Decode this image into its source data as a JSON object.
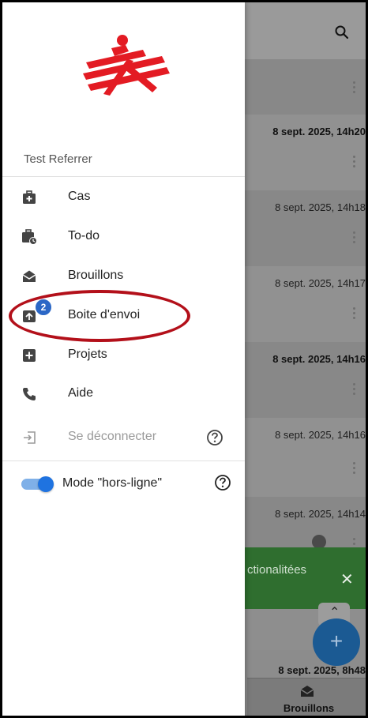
{
  "drawer": {
    "user_name": "Test Referrer",
    "items": [
      {
        "label": "Cas",
        "icon": "medical-briefcase-icon"
      },
      {
        "label": "To-do",
        "icon": "briefcase-clock-icon"
      },
      {
        "label": "Brouillons",
        "icon": "open-envelope-icon"
      },
      {
        "label": "Boite d'envoi",
        "icon": "outbox-icon",
        "badge": "2"
      },
      {
        "label": "Projets",
        "icon": "plus-square-icon"
      },
      {
        "label": "Aide",
        "icon": "phone-icon"
      }
    ],
    "logout_label": "Se déconnecter",
    "offline_mode_label": "Mode \"hors-ligne\"",
    "offline_mode_enabled": true
  },
  "background": {
    "rows": [
      {
        "date": ""
      },
      {
        "date": "8 sept. 2025, 14h20"
      },
      {
        "date": "8 sept. 2025, 14h18"
      },
      {
        "date": "8 sept. 2025, 14h17"
      },
      {
        "date": "8 sept. 2025, 14h16"
      },
      {
        "date": "8 sept. 2025, 14h16"
      },
      {
        "date": "8 sept. 2025, 14h14"
      },
      {
        "date": "8 sept. 2025, 8h48"
      }
    ],
    "snackbar_text": "ctionalitées",
    "bottom_nav_label": "Brouillons"
  },
  "colors": {
    "accent": "#1f73e0",
    "logo_red": "#e31b23",
    "highlight_ellipse": "#b3101a",
    "snackbar": "#2f6e2f"
  }
}
